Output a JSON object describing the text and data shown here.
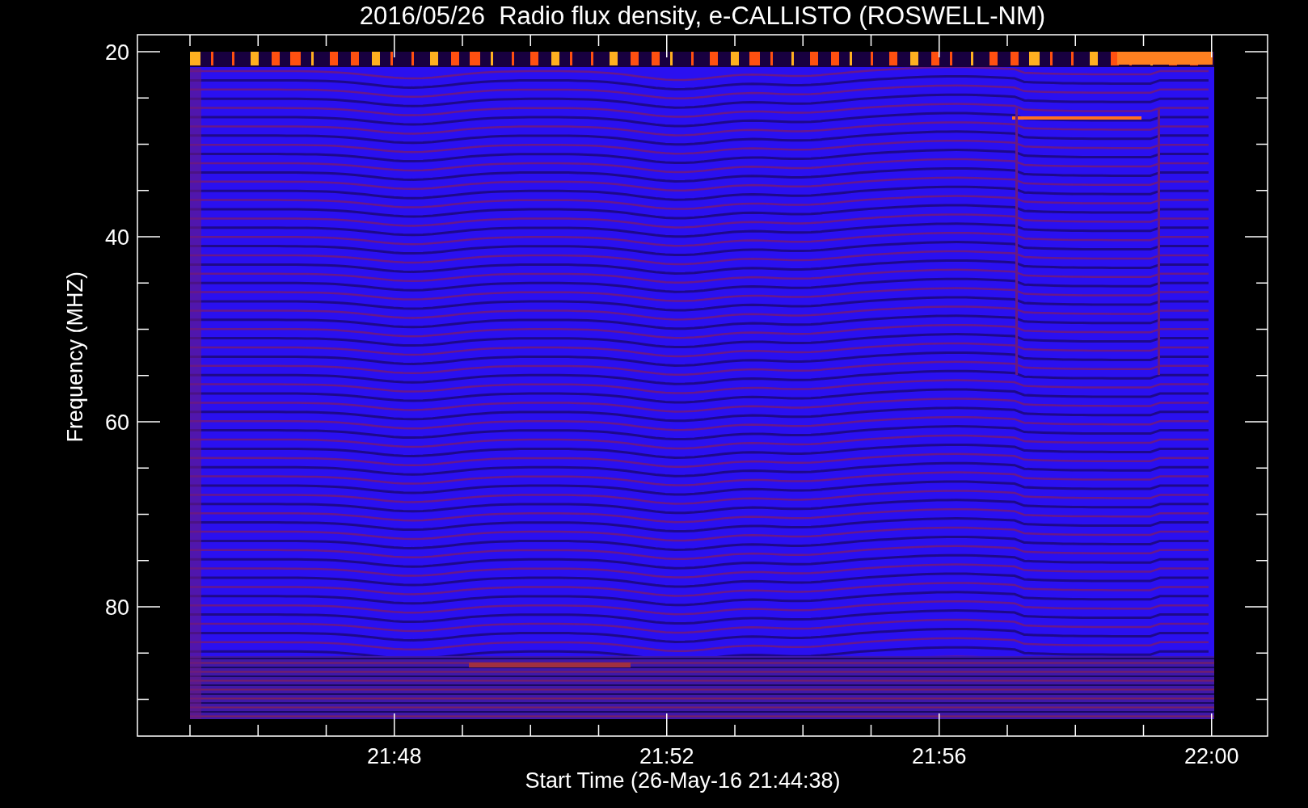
{
  "plot": {
    "title": "2016/05/26  Radio flux density, e-CALLISTO (ROSWELL-NM)",
    "ylabel": "Frequency (MHZ)",
    "xlabel": "Start Time (26-May-16 21:44:38)",
    "y_tick_labels": [
      "20",
      "40",
      "60",
      "80"
    ],
    "x_tick_labels": [
      "21:48",
      "21:52",
      "21:56",
      "22:00"
    ]
  }
}
